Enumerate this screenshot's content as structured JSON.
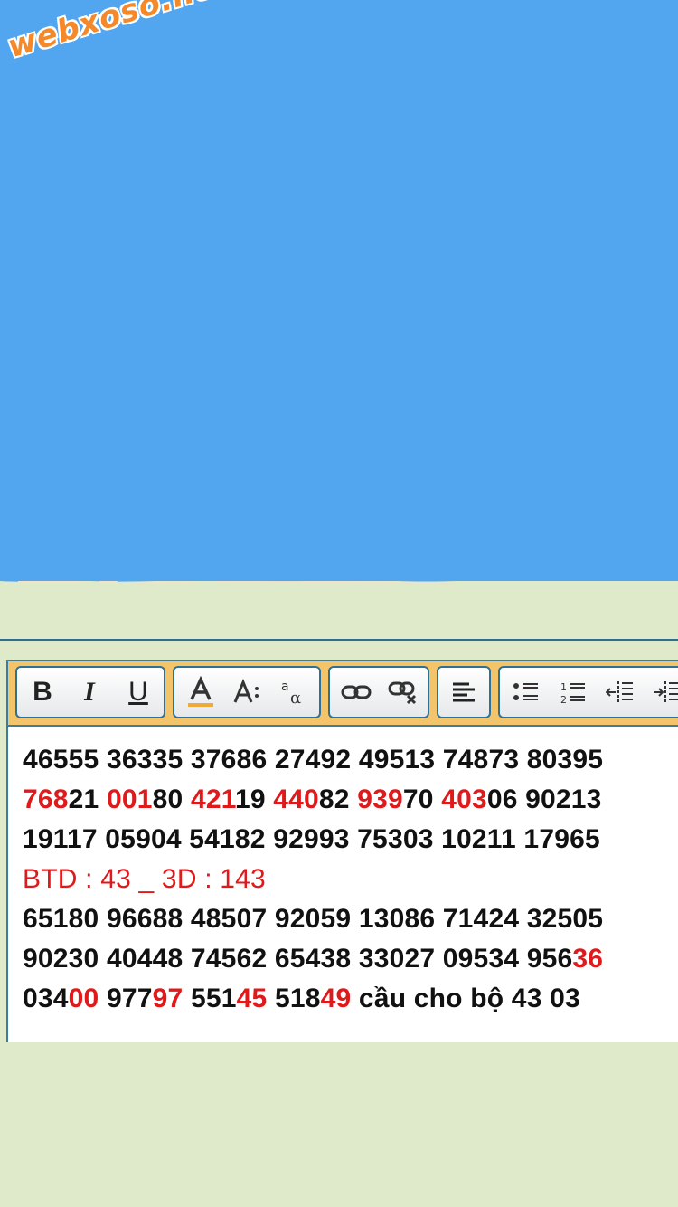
{
  "watermark": "webxoso.net",
  "toolbar": {
    "bold": "B",
    "italic": "I",
    "underline": "U"
  },
  "lines": [
    [
      {
        "t": "46555 36335 37686 27492 49513 74873 80395",
        "c": ""
      }
    ],
    [
      {
        "t": "768",
        "c": "red"
      },
      {
        "t": "21 ",
        "c": ""
      },
      {
        "t": "001",
        "c": "red"
      },
      {
        "t": "80 ",
        "c": ""
      },
      {
        "t": "421",
        "c": "red"
      },
      {
        "t": "19 ",
        "c": ""
      },
      {
        "t": "440",
        "c": "red"
      },
      {
        "t": "82 ",
        "c": ""
      },
      {
        "t": "939",
        "c": "red"
      },
      {
        "t": "70 ",
        "c": ""
      },
      {
        "t": "403",
        "c": "red"
      },
      {
        "t": "06 90213",
        "c": ""
      }
    ],
    [
      {
        "t": "19117 05904 54182 92993 75303 10211 17965",
        "c": ""
      }
    ],
    [
      {
        "t": "BTD : 43 _ 3D : 143",
        "c": "plain"
      }
    ],
    [
      {
        "t": "65180 96688 48507 92059 13086 71424 32505",
        "c": ""
      }
    ],
    [
      {
        "t": "90230 40448 74562 65438 33027 09534 956",
        "c": ""
      },
      {
        "t": "36",
        "c": "red"
      }
    ],
    [
      {
        "t": "034",
        "c": ""
      },
      {
        "t": "00",
        "c": "red"
      },
      {
        "t": " 977",
        "c": ""
      },
      {
        "t": "97",
        "c": "red"
      },
      {
        "t": " 551",
        "c": ""
      },
      {
        "t": "45",
        "c": "red"
      },
      {
        "t": " 518",
        "c": ""
      },
      {
        "t": "49",
        "c": "red"
      },
      {
        "t": " cầu cho bộ 43 03",
        "c": ""
      }
    ]
  ],
  "colors": {
    "sky": "#52a5ef",
    "panel": "#dfeacb",
    "accent": "#e0191b",
    "toolbar": "#f4c46a"
  }
}
